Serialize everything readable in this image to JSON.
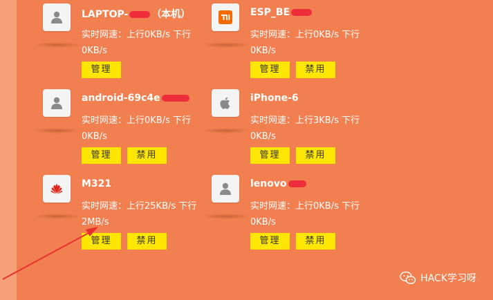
{
  "devices": [
    {
      "name": "LAPTOP-",
      "name_suffix": "（本机）",
      "redacted": true,
      "icon": "person-icon",
      "speed": "实时网速：上行0KB/s 下行0KB/s",
      "buttons": [
        "管理"
      ]
    },
    {
      "name": "ESP_BE",
      "name_suffix": "",
      "redacted": true,
      "icon": "xiaomi-logo-icon",
      "speed": "实时网速：上行0KB/s 下行0KB/s",
      "buttons": [
        "管理",
        "禁用"
      ]
    },
    {
      "name": "android-69c4e",
      "name_suffix": "",
      "redacted": true,
      "icon": "person-icon",
      "speed": "实时网速：上行0KB/s 下行0KB/s",
      "buttons": [
        "管理",
        "禁用"
      ]
    },
    {
      "name": "iPhone-6",
      "name_suffix": "",
      "redacted": false,
      "icon": "apple-logo-icon",
      "speed": "实时网速：上行3KB/s 下行0KB/s",
      "buttons": [
        "管理",
        "禁用"
      ]
    },
    {
      "name": "M321",
      "name_suffix": "",
      "redacted": false,
      "icon": "huawei-logo-icon",
      "speed": "实时网速：上行25KB/s 下行2MB/s",
      "buttons": [
        "管理",
        "禁用"
      ]
    },
    {
      "name": "lenovo",
      "name_suffix": "",
      "redacted": true,
      "icon": "person-icon",
      "speed": "实时网速：上行0KB/s 下行0KB/s",
      "buttons": [
        "管理",
        "禁用"
      ]
    }
  ],
  "watermark": {
    "text": "HACK学习呀",
    "icon": "wechat-icon"
  },
  "colors": {
    "background": "#f27f4f",
    "button": "#ffe600",
    "redaction": "#ee2d3a",
    "arrow": "#e8302f"
  }
}
